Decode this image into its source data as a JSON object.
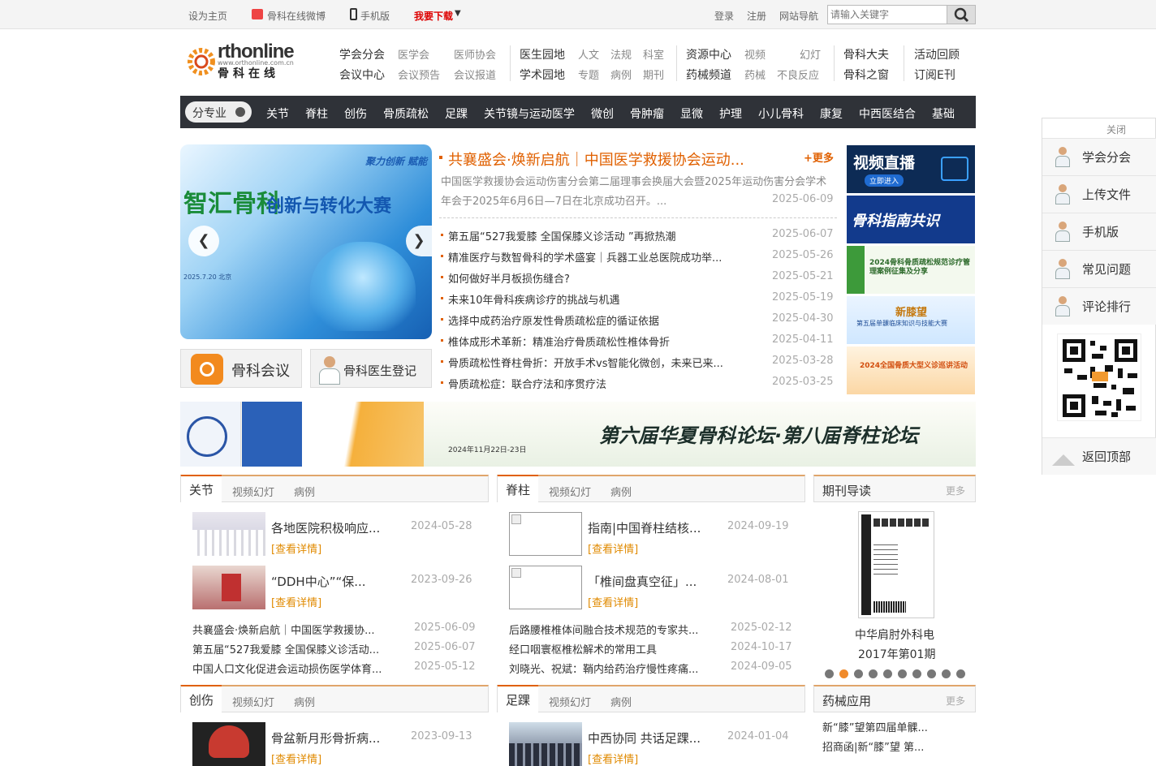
{
  "topbar": {
    "left_links": [
      "设为主页",
      "骨科在线微博",
      "手机版",
      "我要下载"
    ],
    "right_links": [
      "登录",
      "注册",
      "网站导航"
    ],
    "search_placeholder": "请输入关键字"
  },
  "logo": {
    "brand": "rthonline",
    "url": "www.orthonline.com.cn",
    "cn": "骨科在线"
  },
  "nav": {
    "groups": [
      {
        "main": [
          "学会分会",
          "会议中心"
        ],
        "sub": [
          [
            "医学会",
            "医师协会"
          ],
          [
            "会议预告",
            "会议报道"
          ]
        ]
      },
      {
        "main": [
          "医生园地",
          "学术园地"
        ],
        "sub": [
          [
            "人文",
            "法规",
            "科室"
          ],
          [
            "专题",
            "病例",
            "期刊"
          ]
        ]
      },
      {
        "main": [
          "资源中心",
          "药械频道"
        ],
        "sub": [
          [
            "视频",
            "幻灯"
          ],
          [
            "药械",
            "不良反应"
          ]
        ]
      },
      {
        "main": [
          "骨科大夫",
          "骨科之窗"
        ],
        "sub": []
      },
      {
        "main": [
          "活动回顾",
          "订阅E刊"
        ],
        "sub": []
      }
    ]
  },
  "categories": {
    "specialty_label": "分专业",
    "items": [
      "关节",
      "脊柱",
      "创伤",
      "骨质疏松",
      "足踝",
      "关节镜与运动医学",
      "微创",
      "骨肿瘤",
      "显微",
      "护理",
      "小儿骨科",
      "康复",
      "中西医结合",
      "基础"
    ]
  },
  "slider": {
    "caption_top": "聚力创新 赋能",
    "title": "智汇骨科",
    "subtitle": "创新与转化大赛",
    "date": "2025.7.20 北京"
  },
  "quick_buttons": {
    "conference": "骨科会议",
    "doctor": "骨科医生登记"
  },
  "headline": {
    "title": "共襄盛会·焕新启航｜中国医学救援协会运动...",
    "more": "+更多",
    "summary": "中国医学救援协会运动伤害分会第二届理事会换届大会暨2025年运动伤害分会学术年会于2025年6月6日—7日在北京成功召开。...",
    "date": "2025-06-09"
  },
  "news": [
    {
      "title": "第五届“527我爱膝 全国保膝义诊活动 ”再掀热潮",
      "date": "2025-06-07"
    },
    {
      "title": "精准医疗与数智骨科的学术盛宴｜兵器工业总医院成功举...",
      "date": "2025-05-26"
    },
    {
      "title": "如何做好半月板损伤缝合?",
      "date": "2025-05-21"
    },
    {
      "title": "未来10年骨科疾病诊疗的挑战与机遇",
      "date": "2025-05-19"
    },
    {
      "title": "选择中成药治疗原发性骨质疏松症的循证依据",
      "date": "2025-04-30"
    },
    {
      "title": "椎体成形术革新：精准治疗骨质疏松性椎体骨折",
      "date": "2025-04-11"
    },
    {
      "title": "骨质疏松性脊柱骨折：开放手术vs智能化微创，未来已来...",
      "date": "2025-03-28"
    },
    {
      "title": "骨质疏松症：联合疗法和序贯疗法",
      "date": "2025-03-25"
    }
  ],
  "right_ads": {
    "video_title": "视频直播",
    "video_btn": "立即进入",
    "guide": "骨科指南共识",
    "ad3": "2024骨科骨质疏松规范诊疗管理案例征集及分享",
    "ad4_title": "新膝望",
    "ad4_sub": "第五届单髁临床知识与技能大赛",
    "ad5": "2024全国骨质大型义诊巡讲活动"
  },
  "banner": {
    "text": "第六届华夏骨科论坛·第八届脊柱论坛",
    "date": "2024年11月22日-23日"
  },
  "sections": [
    {
      "name": "关节",
      "tabs": [
        "视频幻灯",
        "病例"
      ],
      "features": [
        {
          "title": "各地医院积极响应...",
          "date": "2024-05-28",
          "detail": "[查看详情]"
        },
        {
          "title": "“DDH中心”“保...",
          "date": "2023-09-26",
          "detail": "[查看详情]"
        }
      ],
      "list": [
        {
          "title": "共襄盛会·焕新启航｜中国医学救援协...",
          "date": "2025-06-09"
        },
        {
          "title": "第五届“527我爱膝 全国保膝义诊活动...",
          "date": "2025-06-07"
        },
        {
          "title": "中国人口文化促进会运动损伤医学体育...",
          "date": "2025-05-12"
        }
      ]
    },
    {
      "name": "脊柱",
      "tabs": [
        "视频幻灯",
        "病例"
      ],
      "features": [
        {
          "title": "指南|中国脊柱结核...",
          "date": "2024-09-19",
          "detail": "[查看详情]"
        },
        {
          "title": "「椎间盘真空征」...",
          "date": "2024-08-01",
          "detail": "[查看详情]"
        }
      ],
      "list": [
        {
          "title": "后路腰椎椎体间融合技术规范的专家共...",
          "date": "2025-02-12"
        },
        {
          "title": "经口咽寰枢椎松解术的常用工具",
          "date": "2024-10-17"
        },
        {
          "title": "刘晓光、祝斌：鞘内给药治疗慢性疼痛...",
          "date": "2024-09-05"
        }
      ]
    },
    {
      "name": "创伤",
      "tabs": [
        "视频幻灯",
        "病例"
      ],
      "features": [
        {
          "title": "骨盆新月形骨折病...",
          "date": "2023-09-13",
          "detail": "[查看详情]"
        }
      ]
    },
    {
      "name": "足踝",
      "tabs": [
        "视频幻灯",
        "病例"
      ],
      "features": [
        {
          "title": "中西协同 共话足踝...",
          "date": "2024-01-04",
          "detail": "[查看详情]"
        }
      ]
    }
  ],
  "journal": {
    "title": "期刊导读",
    "more": "更多",
    "name": "中华肩肘外科电",
    "issue": "2017年第01期",
    "active_dot": 2,
    "dot_count": 10
  },
  "devices": {
    "title": "药械应用",
    "more": "更多",
    "items": [
      "新“膝”望第四届单髁...",
      "招商函|新“膝”望 第..."
    ]
  },
  "sidebar": {
    "close": "关闭",
    "items": [
      "学会分会",
      "上传文件",
      "手机版",
      "常见问题",
      "评论排行"
    ],
    "back_top": "返回顶部"
  },
  "colors": {
    "accent": "#e06000",
    "nav_bg": "#2f3238",
    "tab_border": "#e0a56b",
    "link_orange": "#e08a00"
  }
}
